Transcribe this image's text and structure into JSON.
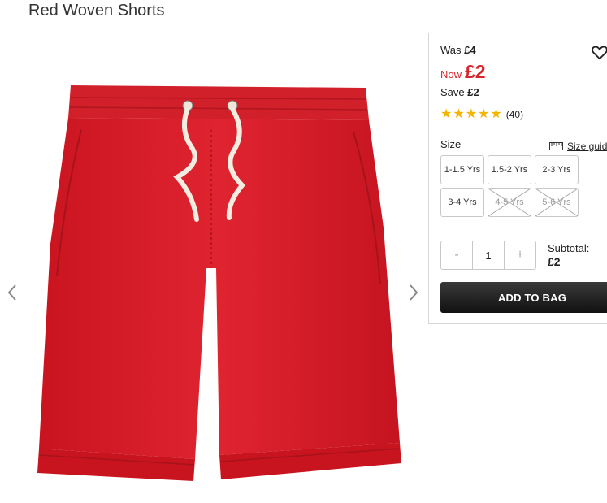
{
  "product": {
    "title": "Red Woven Shorts"
  },
  "price": {
    "was_label": "Was",
    "was_value": "£4",
    "now_label": "Now",
    "now_value": "£2",
    "save_label": "Save",
    "save_value": "£2"
  },
  "rating": {
    "stars": 5,
    "review_count": "(40)"
  },
  "size": {
    "label": "Size",
    "guide_label": "Size guide",
    "options": [
      {
        "label": "1-1.5 Yrs",
        "available": true
      },
      {
        "label": "1.5-2 Yrs",
        "available": true
      },
      {
        "label": "2-3 Yrs",
        "available": true
      },
      {
        "label": "3-4 Yrs",
        "available": true
      },
      {
        "label": "4-5 Yrs",
        "available": false
      },
      {
        "label": "5-6 Yrs",
        "available": false
      }
    ]
  },
  "quantity": {
    "minus": "-",
    "value": "1",
    "plus": "+"
  },
  "subtotal": {
    "label": "Subtotal:",
    "value": "£2"
  },
  "cta": {
    "add_to_bag": "ADD TO BAG"
  },
  "colors": {
    "sale_red": "#d8242a",
    "star_gold": "#f4b400",
    "product_red": "#d9202c"
  },
  "icons": {
    "prev": "chevron-left-icon",
    "next": "chevron-right-icon",
    "wishlist": "heart-icon",
    "size_guide": "ruler-icon"
  }
}
